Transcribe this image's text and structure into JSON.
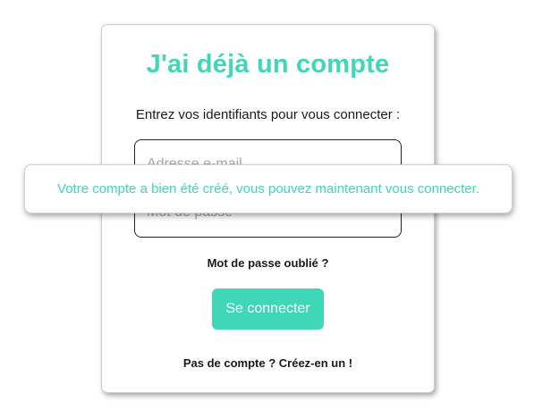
{
  "login_card": {
    "title": "J'ai déjà un compte",
    "subtitle": "Entrez vos identifiants pour vous connecter :",
    "email_placeholder": "Adresse e-mail",
    "password_placeholder": "Mot de passe",
    "forgot_password": "Mot de passe oublié ?",
    "login_button": "Se connecter",
    "signup_link": "Pas de compte ? Créez-en un !"
  },
  "toast": {
    "message": "Votre compte a bien été créé, vous pouvez maintenant vous connecter."
  },
  "colors": {
    "accent": "#40d6b8",
    "text": "#1a1a1a",
    "background": "#ffffff"
  }
}
